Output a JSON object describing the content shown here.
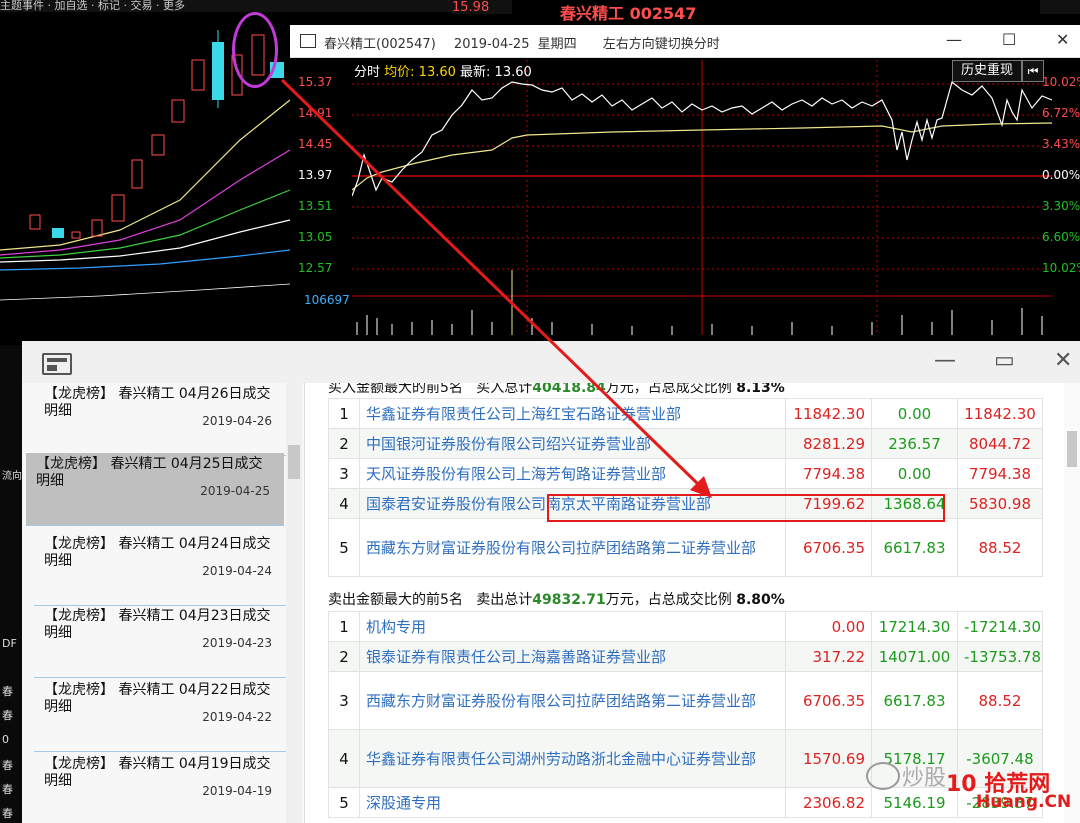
{
  "background": {
    "toolbar_text": "主题事件 · 加自选 · 标记 · 交易 · 更多",
    "last_price": "15.98",
    "title": "春兴精工 002547",
    "left_labels": [
      "DF",
      "春",
      "春",
      "0",
      "春",
      "春",
      "春",
      "春"
    ],
    "side_text": [
      "流向"
    ]
  },
  "intraday": {
    "window_title": "春兴精工(002547)",
    "date": "2019-04-25",
    "weekday": "星期四",
    "hint": "左右方向键切换分时",
    "header_label": "分时",
    "avg_label": "均价: 13.60",
    "latest_label": "最新: 13.60",
    "replay_button": "历史重现",
    "back_icon": "⏮",
    "price_levels": [
      "15.37",
      "14.91",
      "14.45",
      "13.97",
      "13.51",
      "13.05",
      "12.57"
    ],
    "pct_levels": [
      "10.02%",
      "6.72%",
      "3.43%",
      "0.00%",
      "3.30%",
      "6.60%",
      "10.02%"
    ],
    "volume_label": "106697",
    "colors": {
      "up": "#ff4d4d",
      "down": "#20c020",
      "price_line": "#ffffff",
      "avg_line": "#f0e68c"
    }
  },
  "dragon_tiger": {
    "side_items": [
      {
        "title": "【龙虎榜】 春兴精工 04月26日成交",
        "sub": "明细",
        "date": "2019-04-26"
      },
      {
        "title": "【龙虎榜】 春兴精工 04月25日成交",
        "sub": "明细",
        "date": "2019-04-25"
      },
      {
        "title": "【龙虎榜】 春兴精工 04月24日成交",
        "sub": "明细",
        "date": "2019-04-24"
      },
      {
        "title": "【龙虎榜】 春兴精工 04月23日成交",
        "sub": "明细",
        "date": "2019-04-23"
      },
      {
        "title": "【龙虎榜】 春兴精工 04月22日成交",
        "sub": "明细",
        "date": "2019-04-22"
      },
      {
        "title": "【龙虎榜】 春兴精工 04月19日成交",
        "sub": "明细",
        "date": "2019-04-19"
      }
    ],
    "buy_section": {
      "prefix": "买入金额最大的前5名",
      "total_label": "买入总计",
      "total": "40418.84",
      "suffix": "万元，占总成交比例",
      "ratio": "8.13%"
    },
    "buy_rows": [
      {
        "rank": "1",
        "name": "华鑫证券有限责任公司上海红宝石路证券营业部",
        "buy": "11842.30",
        "sell": "0.00",
        "net": "11842.30"
      },
      {
        "rank": "2",
        "name": "中国银河证券股份有限公司绍兴证券营业部",
        "buy": "8281.29",
        "sell": "236.57",
        "net": "8044.72"
      },
      {
        "rank": "3",
        "name": "天风证券股份有限公司上海芳甸路证券营业部",
        "buy": "7794.38",
        "sell": "0.00",
        "net": "7794.38"
      },
      {
        "rank": "4",
        "name": "国泰君安证券股份有限公司南京太平南路证券营业部",
        "buy": "7199.62",
        "sell": "1368.64",
        "net": "5830.98"
      },
      {
        "rank": "5",
        "name": "西藏东方财富证券股份有限公司拉萨团结路第二证券营业部",
        "buy": "6706.35",
        "sell": "6617.83",
        "net": "88.52"
      }
    ],
    "sell_section": {
      "prefix": "卖出金额最大的前5名",
      "total_label": "卖出总计",
      "total": "49832.71",
      "suffix": "万元，占总成交比例",
      "ratio": "8.80%"
    },
    "sell_rows": [
      {
        "rank": "1",
        "name": "机构专用",
        "buy": "0.00",
        "sell": "17214.30",
        "net": "-17214.30"
      },
      {
        "rank": "2",
        "name": "银泰证券有限责任公司上海嘉善路证券营业部",
        "buy": "317.22",
        "sell": "14071.00",
        "net": "-13753.78"
      },
      {
        "rank": "3",
        "name": "西藏东方财富证券股份有限公司拉萨团结路第二证券营业部",
        "buy": "6706.35",
        "sell": "6617.83",
        "net": "88.52"
      },
      {
        "rank": "4",
        "name": "华鑫证券有限责任公司湖州劳动路浙北金融中心证券营业部",
        "buy": "1570.69",
        "sell": "5178.17",
        "net": "-3607.48"
      },
      {
        "rank": "5",
        "name": "深股通专用",
        "buy": "2306.82",
        "sell": "5146.19",
        "net": "-2839.37"
      }
    ]
  },
  "watermark": {
    "text": "炒股",
    "brand": "10 拾荒网",
    "site": "Huang.CN"
  }
}
